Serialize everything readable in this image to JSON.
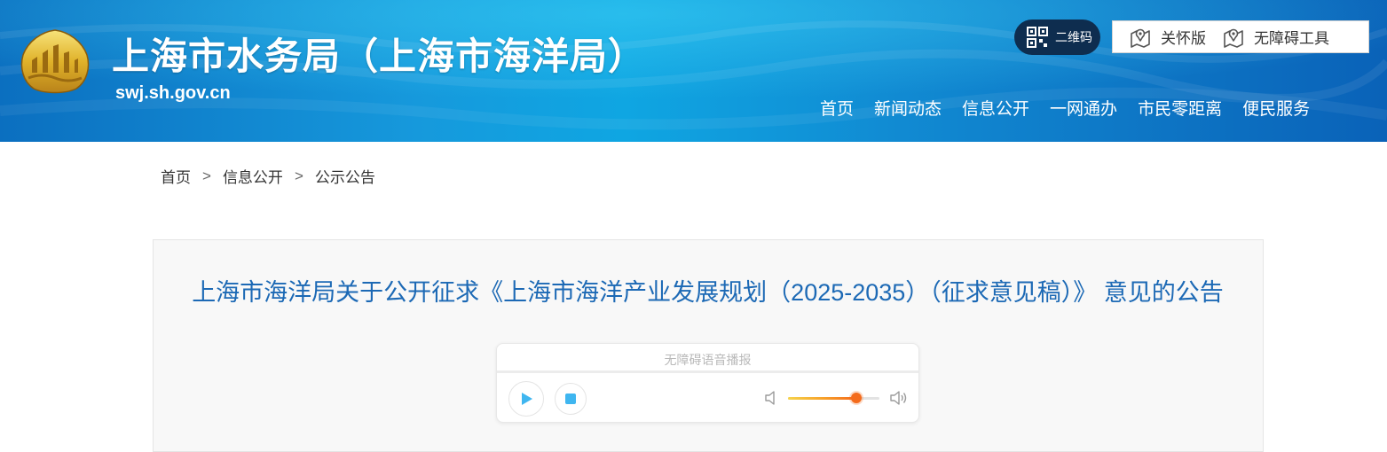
{
  "header": {
    "site_title": "上海市水务局（上海市海洋局）",
    "site_url": "swj.sh.gov.cn",
    "qr_label": "二维码",
    "tools": [
      {
        "label": "关怀版",
        "icon": "map-pin-icon"
      },
      {
        "label": "无障碍工具",
        "icon": "map-pin-icon"
      }
    ],
    "nav": [
      "首页",
      "新闻动态",
      "信息公开",
      "一网通办",
      "市民零距离",
      "便民服务"
    ],
    "colors": {
      "banner_dark": "#0a62b8",
      "banner_light": "#0fa6e2",
      "qr_pill": "#0e2d4f"
    }
  },
  "breadcrumb": {
    "items": [
      "首页",
      "信息公开",
      "公示公告"
    ],
    "separator": ">"
  },
  "article": {
    "title": "上海市海洋局关于公开征求《上海市海洋产业发展规划（2025-2035）（征求意见稿）》 意见的公告",
    "title_color": "#1c69b5"
  },
  "audio_player": {
    "label": "无障碍语音播报",
    "progress": 0.0,
    "volume": 0.75,
    "icons": [
      "play-icon",
      "stop-icon",
      "volume-low-icon",
      "volume-high-icon"
    ],
    "accent": "#3fb6f0"
  }
}
